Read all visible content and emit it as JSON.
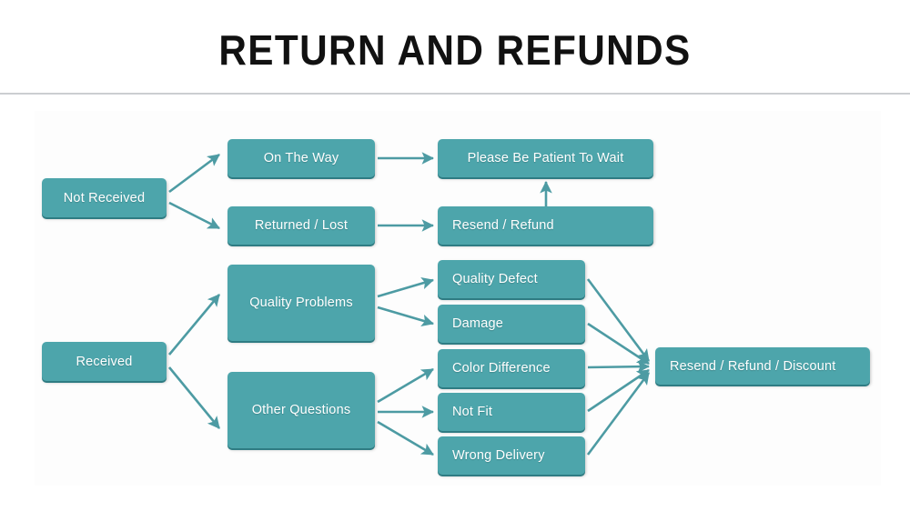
{
  "slide": {
    "title": "RETURN AND REFUNDS",
    "theme": {
      "node_fill": "#4da5ab",
      "node_shadow": "#2f7c83",
      "node_text": "#ffffff",
      "arrow": "#4d9ba3",
      "background": "#ffffff",
      "divider": "#b9bcc0",
      "title_text": "#111111"
    }
  },
  "flowchart": {
    "type": "flowchart",
    "nodes": {
      "not_received": "Not Received",
      "on_the_way": "On The Way",
      "returned_lost": "Returned / Lost",
      "please_wait": "Please Be Patient To Wait",
      "resend_refund": "Resend / Refund",
      "received": "Received",
      "quality_problems": "Quality Problems",
      "other_questions": "Other Questions",
      "quality_defect": "Quality Defect",
      "damage": "Damage",
      "color_difference": "Color Difference",
      "not_fit": "Not Fit",
      "wrong_delivery": "Wrong Delivery",
      "resend_refund_discount": "Resend / Refund / Discount"
    },
    "edges": [
      {
        "from": "not_received",
        "to": "on_the_way"
      },
      {
        "from": "not_received",
        "to": "returned_lost"
      },
      {
        "from": "on_the_way",
        "to": "please_wait"
      },
      {
        "from": "returned_lost",
        "to": "resend_refund"
      },
      {
        "from": "resend_refund",
        "to": "please_wait"
      },
      {
        "from": "received",
        "to": "quality_problems"
      },
      {
        "from": "received",
        "to": "other_questions"
      },
      {
        "from": "quality_problems",
        "to": "quality_defect"
      },
      {
        "from": "quality_problems",
        "to": "damage"
      },
      {
        "from": "other_questions",
        "to": "color_difference"
      },
      {
        "from": "other_questions",
        "to": "not_fit"
      },
      {
        "from": "other_questions",
        "to": "wrong_delivery"
      },
      {
        "from": "quality_defect",
        "to": "resend_refund_discount"
      },
      {
        "from": "damage",
        "to": "resend_refund_discount"
      },
      {
        "from": "color_difference",
        "to": "resend_refund_discount"
      },
      {
        "from": "not_fit",
        "to": "resend_refund_discount"
      },
      {
        "from": "wrong_delivery",
        "to": "resend_refund_discount"
      }
    ]
  }
}
